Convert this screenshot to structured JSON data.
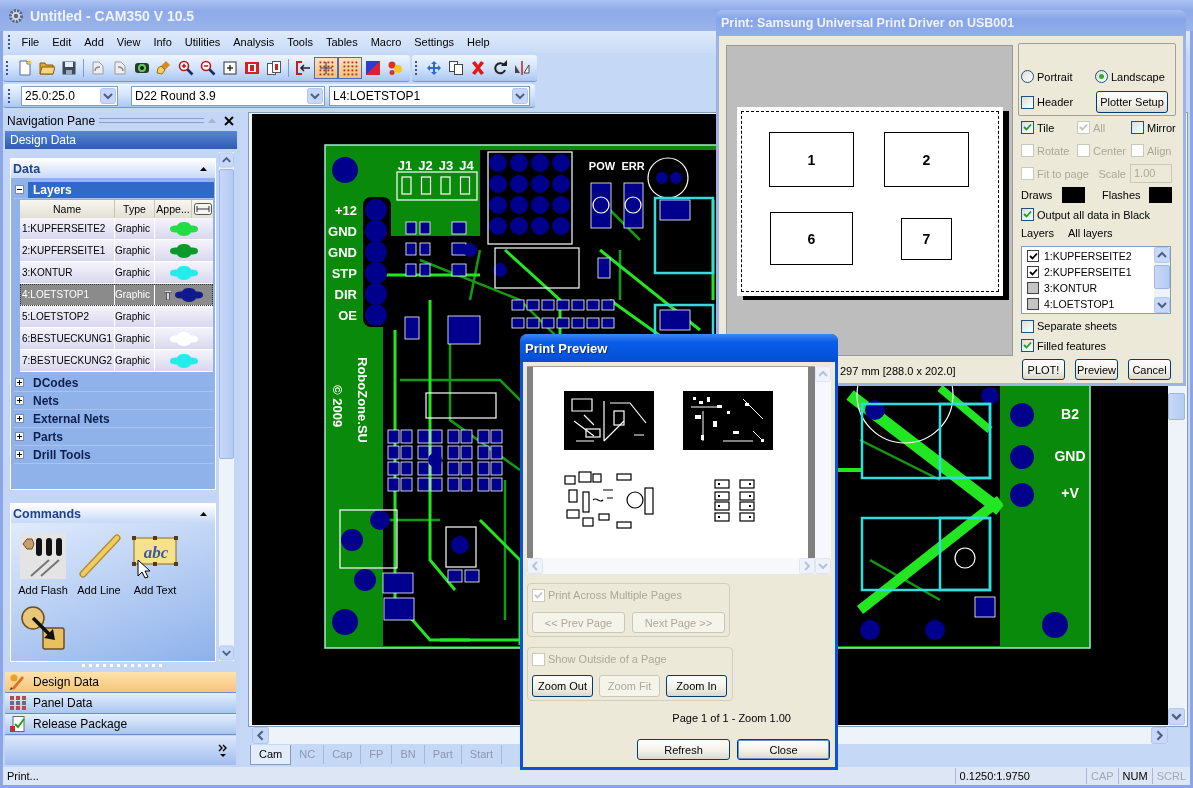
{
  "window": {
    "title": "Untitled - CAM350 V 10.5",
    "active": false
  },
  "menu": [
    "File",
    "Edit",
    "Add",
    "View",
    "Info",
    "Utilities",
    "Analysis",
    "Tools",
    "Tables",
    "Macro",
    "Settings",
    "Help"
  ],
  "toolbars": [
    {
      "sections": [
        [
          {
            "kind": "new",
            "on": false
          },
          {
            "kind": "open",
            "on": false
          },
          {
            "kind": "save",
            "on": false
          }
        ],
        [
          {
            "kind": "undo",
            "on": false
          },
          {
            "kind": "redo",
            "on": false
          },
          {
            "kind": "lens",
            "on": false
          },
          {
            "kind": "brush",
            "on": false
          },
          {
            "kind": "zoomin",
            "on": false
          },
          {
            "kind": "zoomout",
            "on": false
          },
          {
            "kind": "zoombox",
            "on": false
          },
          {
            "kind": "window",
            "on": false
          },
          {
            "kind": "pages",
            "on": false
          }
        ],
        [
          {
            "kind": "snap",
            "on": false
          },
          {
            "kind": "crossgrid",
            "on": true
          },
          {
            "kind": "grid",
            "on": true
          },
          {
            "kind": "color",
            "on": false
          },
          {
            "kind": "flash",
            "on": false
          }
        ]
      ]
    },
    {
      "sections": [
        [
          {
            "kind": "move",
            "on": false
          },
          {
            "kind": "copy",
            "on": false
          },
          {
            "kind": "delete",
            "on": false
          },
          {
            "kind": "rotate",
            "on": false
          },
          {
            "kind": "mirror",
            "on": false
          }
        ]
      ]
    }
  ],
  "selectors": [
    {
      "value": "25.0:25.0"
    },
    {
      "value": "D22 Round 3.9"
    },
    {
      "value": "L4:LOETSTOP1"
    }
  ],
  "navigation_pane": {
    "title": "Navigation Pane",
    "section": "Design Data",
    "data_panel": {
      "title": "Data",
      "groups": [
        {
          "label": "Layers",
          "expanded": true,
          "columns": [
            "Name",
            "Type",
            "Appe..."
          ],
          "rows": [
            {
              "name": "1:KUPFERSEITE2",
              "type": "Graphic",
              "color": "#22dd44",
              "selected": false
            },
            {
              "name": "2:KUPFERSEITE1",
              "type": "Graphic",
              "color": "#0a9a2a",
              "selected": false
            },
            {
              "name": "3:KONTUR",
              "type": "Graphic",
              "color": "#22eeee",
              "selected": false
            },
            {
              "name": "4:LOETSTOP1",
              "type": "Graphic",
              "color": "#101a8a",
              "selected": true
            },
            {
              "name": "5:LOETSTOP2",
              "type": "Graphic",
              "selected": false
            },
            {
              "name": "6:BESTUECKUNG1",
              "type": "Graphic",
              "color": "#ffffff",
              "selected": false
            },
            {
              "name": "7:BESTUECKUNG2",
              "type": "Graphic",
              "color": "#22eeee",
              "selected": false
            }
          ]
        },
        {
          "label": "DCodes",
          "expanded": false
        },
        {
          "label": "Nets",
          "expanded": false
        },
        {
          "label": "External Nets",
          "expanded": false
        },
        {
          "label": "Parts",
          "expanded": false
        },
        {
          "label": "Drill Tools",
          "expanded": false
        }
      ]
    },
    "commands_panel": {
      "title": "Commands",
      "items": [
        {
          "kind": "flash",
          "label": "Add Flash"
        },
        {
          "kind": "line",
          "label": "Add Line"
        },
        {
          "kind": "text",
          "label": "Add Text",
          "glyph": "abc"
        },
        {
          "kind": "connect"
        }
      ]
    },
    "bars": [
      {
        "kind": "design",
        "label": "Design Data",
        "selected": true
      },
      {
        "kind": "panel",
        "label": "Panel Data",
        "selected": false
      },
      {
        "kind": "release",
        "label": "Release Package",
        "selected": false
      }
    ]
  },
  "canvas": {
    "jumper_labels": [
      "J1",
      "J2",
      "J3",
      "J4"
    ],
    "led_labels": [
      "POW",
      "ERR"
    ],
    "connector_labels": [
      "+12",
      "GND",
      "GND",
      "STP",
      "DIR",
      "OE"
    ],
    "credit_lines": [
      "RoboZone.SU",
      "© 2009"
    ],
    "power_labels": [
      "B2",
      "GND",
      "+V"
    ]
  },
  "tabs": [
    {
      "label": "Cam",
      "selected": true
    },
    {
      "label": "NC",
      "selected": false
    },
    {
      "label": "Cap",
      "selected": false
    },
    {
      "label": "FP",
      "selected": false
    },
    {
      "label": "BN",
      "selected": false
    },
    {
      "label": "Part",
      "selected": false
    },
    {
      "label": "Start",
      "selected": false
    }
  ],
  "status_bar": {
    "text": "Print...",
    "coordinates": "0.1250:1.9750",
    "indicators": [
      {
        "label": "CAP",
        "on": false
      },
      {
        "label": "NUM",
        "on": true
      },
      {
        "label": "SCRL",
        "on": false
      }
    ]
  },
  "print_dialog": {
    "title": "Print: Samsung Universal Print Driver on USB001",
    "active": false,
    "tiles": [
      "1",
      "2",
      "6",
      "7"
    ],
    "size_text": "297 mm [288.0 x 202.0]",
    "orientation": [
      {
        "label": "Portrait",
        "selected": false
      },
      {
        "label": "Landscape",
        "selected": true
      }
    ],
    "header": {
      "label": "Header",
      "checked": false
    },
    "plotter_button": "Plotter Setup",
    "options": [
      {
        "label": "Tile",
        "checked": true,
        "disabled": false
      },
      {
        "label": "All",
        "checked": true,
        "disabled": true
      },
      {
        "label": "Mirror",
        "checked": false,
        "disabled": false
      },
      {
        "label": "Rotate",
        "checked": false,
        "disabled": true
      },
      {
        "label": "Center",
        "checked": false,
        "disabled": true
      },
      {
        "label": "Align",
        "checked": false,
        "disabled": true
      },
      {
        "label": "Fit to page",
        "checked": false,
        "disabled": true
      }
    ],
    "scale": {
      "label": "Scale",
      "value": "1.00",
      "disabled": true
    },
    "swatches": [
      {
        "label": "Draws",
        "color": "#000000"
      },
      {
        "label": "Flashes",
        "color": "#000000"
      }
    ],
    "black_output": {
      "label": "Output all data in Black",
      "checked": true
    },
    "layers_row": {
      "label": "Layers",
      "value": "All layers"
    },
    "layers": [
      {
        "name": "1:KUPFERSEITE2",
        "checked": true
      },
      {
        "name": "2:KUPFERSEITE1",
        "checked": true
      },
      {
        "name": "3:KONTUR",
        "checked": false
      },
      {
        "name": "4:LOETSTOP1",
        "checked": false
      }
    ],
    "separate_sheets": {
      "label": "Separate sheets",
      "checked": false
    },
    "filled_features": {
      "label": "Filled features",
      "checked": true
    },
    "buttons": [
      "PLOT!",
      "Preview",
      "Cancel"
    ]
  },
  "preview_dialog": {
    "title": "Print Preview",
    "active": true,
    "multi_page": {
      "label": "Print Across Multiple Pages",
      "checked": true,
      "disabled": true
    },
    "page_buttons": [
      {
        "label": "<< Prev Page",
        "disabled": true
      },
      {
        "label": "Next Page >>",
        "disabled": true
      }
    ],
    "outside": {
      "label": "Show Outside of a Page",
      "checked": false,
      "disabled": true
    },
    "zoom_buttons": [
      {
        "label": "Zoom Out",
        "disabled": false
      },
      {
        "label": "Zoom Fit",
        "disabled": true
      },
      {
        "label": "Zoom In",
        "disabled": false
      }
    ],
    "page_info": "Page 1 of 1 - Zoom 1.00",
    "buttons": [
      {
        "label": "Refresh",
        "default": false
      },
      {
        "label": "Close",
        "default": true
      }
    ]
  }
}
